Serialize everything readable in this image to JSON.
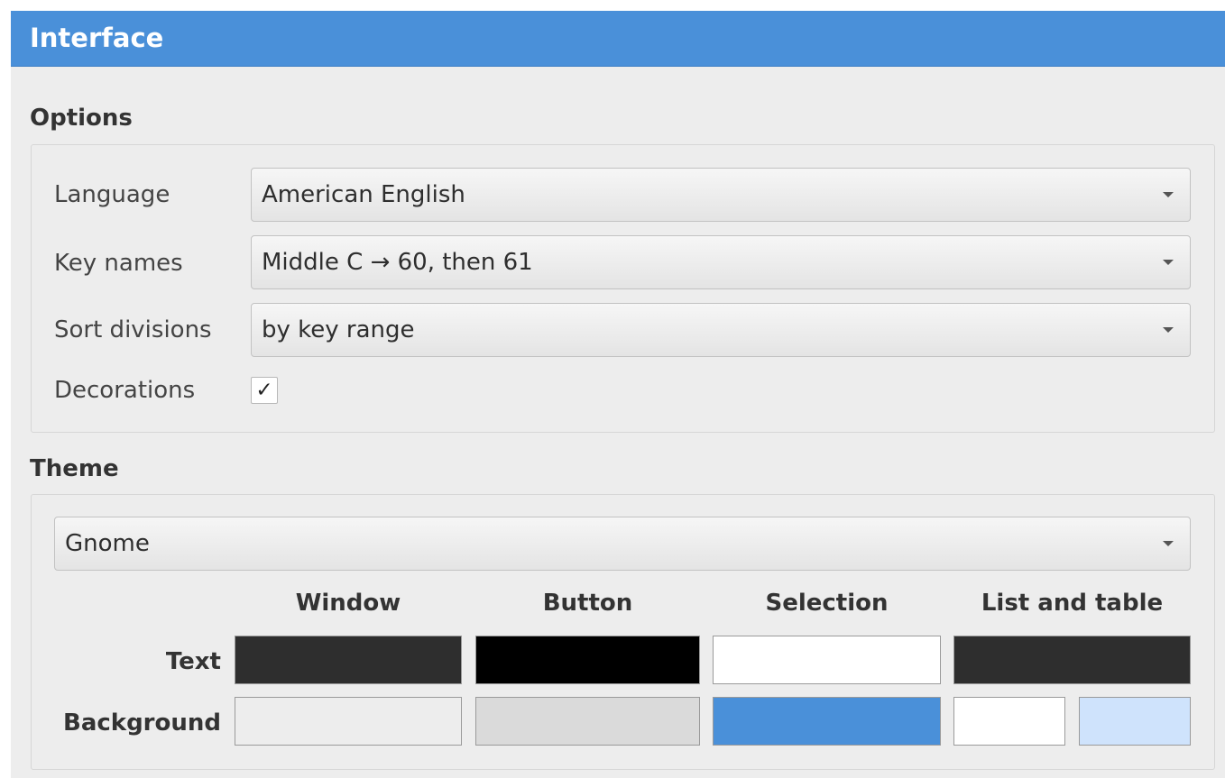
{
  "window": {
    "title": "Interface"
  },
  "options": {
    "section_title": "Options",
    "language": {
      "label": "Language",
      "value": "American English"
    },
    "key_names": {
      "label": "Key names",
      "value": "Middle C → 60, then 61"
    },
    "sort_divisions": {
      "label": "Sort divisions",
      "value": "by key range"
    },
    "decorations": {
      "label": "Decorations",
      "checked": true,
      "check_glyph": "✓"
    }
  },
  "theme": {
    "section_title": "Theme",
    "selected": "Gnome",
    "columns": [
      "Window",
      "Button",
      "Selection",
      "List and table"
    ],
    "rows": {
      "text_label": "Text",
      "background_label": "Background"
    },
    "colors": {
      "text": {
        "window": "#2e2e2e",
        "button": "#000000",
        "selection": "#ffffff",
        "list_and_table": "#2e2e2e"
      },
      "background": {
        "window": "#ededed",
        "button": "#dadada",
        "selection": "#4a90d9",
        "list_and_table_1": "#ffffff",
        "list_and_table_2": "#cfe3fc"
      }
    }
  },
  "accent_color": "#4a90d9",
  "icons": {
    "dropdown": "chevron-down-icon",
    "checkbox": "checkmark-icon"
  }
}
